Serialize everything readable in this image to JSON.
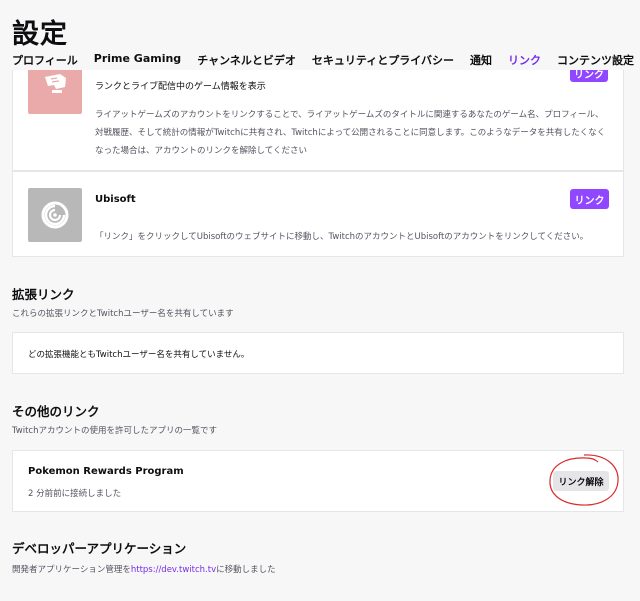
{
  "page": {
    "title": "設定"
  },
  "tabs": [
    {
      "label": "プロフィール",
      "active": false
    },
    {
      "label": "Prime Gaming",
      "active": false
    },
    {
      "label": "チャンネルとビデオ",
      "active": false
    },
    {
      "label": "セキュリティとプライバシー",
      "active": false
    },
    {
      "label": "通知",
      "active": false
    },
    {
      "label": "リンク",
      "active": true
    },
    {
      "label": "コンテンツ設定",
      "active": false
    }
  ],
  "connections": {
    "riot": {
      "subtitle": "ランクとライブ配信中のゲーム情報を表示",
      "description": "ライアットゲームズのアカウントをリンクすることで、ライアットゲームズのタイトルに関連するあなたのゲーム名、プロフィール、対戦履歴、そして統計の情報がTwitchに共有され、Twitchによって公開されることに同意します。このようなデータを共有したくなくなった場合は、アカウントのリンクを解除してください",
      "button_label": "リンク",
      "logo_icon": "riot-fist-icon",
      "logo_color": "#eaaaa9"
    },
    "ubisoft": {
      "title": "Ubisoft",
      "description": "「リンク」をクリックしてUbisoftのウェブサイトに移動し、TwitchのアカウントとUbisoftのアカウントをリンクしてください。",
      "button_label": "リンク",
      "logo_icon": "ubisoft-swirl-icon",
      "logo_color": "#b8b8b8"
    }
  },
  "extensions": {
    "title": "拡張リンク",
    "subtitle": "これらの拡張リンクとTwitchユーザー名を共有しています",
    "empty_text": "どの拡張機能ともTwitchユーザー名を共有していません。"
  },
  "other": {
    "title": "その他のリンク",
    "subtitle": "Twitchアカウントの使用を許可したアプリの一覧です",
    "app": {
      "name": "Pokemon Rewards Program",
      "connected": "2 分前前に接続しました",
      "unlink_label": "リンク解除"
    }
  },
  "developer": {
    "title": "デベロッパーアプリケーション",
    "desc_prefix": "開発者アプリケーション管理を",
    "link_text": "https://dev.twitch.tv",
    "desc_suffix": "に移動しました"
  },
  "colors": {
    "accent": "#9147ff",
    "accent_text": "#772ce8",
    "annotation": "#d92a2a"
  }
}
